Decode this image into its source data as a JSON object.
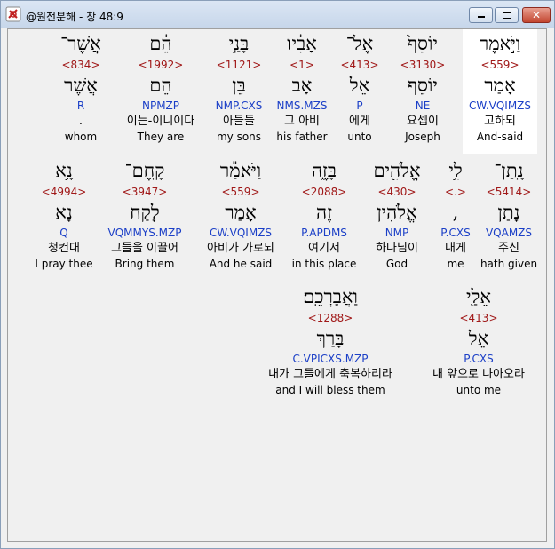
{
  "window": {
    "title": "@원전분해 - 창 48:9"
  },
  "controls": {
    "minimize": "–",
    "maximize": "□",
    "close": "✕"
  },
  "rows": [
    {
      "words": [
        {
          "heb": "וַיֹּ֣אמֶר",
          "num": "<559>",
          "lex": "אָמַר",
          "code": "CW.VQIMZS",
          "kor": "고하되",
          "eng": "And-said",
          "highlight": true
        },
        {
          "heb": "יוֹסֵף֙",
          "num": "<3130>",
          "lex": "יוֹסֵף",
          "code": "NE",
          "kor": "요셉이",
          "eng": "Joseph"
        },
        {
          "heb": "אֶל־",
          "num": "<413>",
          "lex": "אֵל",
          "code": "P",
          "kor": "에게",
          "eng": "unto"
        },
        {
          "heb": "אָבִ֔יו",
          "num": "<1>",
          "lex": "אָב",
          "code": "NMS.MZS",
          "kor": "그 아비",
          "eng": "his father"
        },
        {
          "heb": "בָּנַ֣י",
          "num": "<1121>",
          "lex": "בֵּן",
          "code": "NMP.CXS",
          "kor": "아들들",
          "eng": "my sons"
        },
        {
          "heb": "הֵ֔ם",
          "num": "<1992>",
          "lex": "הֵם",
          "code": "NPMZP",
          "kor": "이는-이니이다",
          "eng": "They are"
        },
        {
          "heb": "אֲשֶׁר־",
          "num": "<834>",
          "lex": "אֲשֶׁר",
          "code": "R",
          "kor": ".",
          "eng": "whom"
        }
      ]
    },
    {
      "words": [
        {
          "heb": "נָֽתַן־",
          "num": "<5414>",
          "lex": "נָתַן",
          "code": "VQAMZS",
          "kor": "주신",
          "eng": "hath given"
        },
        {
          "heb": "לִ֥י",
          "num": "<.>",
          "lex": ",",
          "code": "P.CXS",
          "kor": "내게",
          "eng": "me"
        },
        {
          "heb": "אֱלֹהִ֖ים",
          "num": "<430>",
          "lex": "אֱלֹהִין",
          "code": "NMP",
          "kor": "하나님이",
          "eng": "God"
        },
        {
          "heb": "בָּזֶ֑ה",
          "num": "<2088>",
          "lex": "זֶה",
          "code": "P.APDMS",
          "kor": "여기서",
          "eng": "in this place"
        },
        {
          "heb": "וַיֹּאמַ֕ר",
          "num": "<559>",
          "lex": "אָמַר",
          "code": "CW.VQIMZS",
          "kor": "아비가 가로되",
          "eng": "And he said"
        },
        {
          "heb": "קָֽחֶם־",
          "num": "<3947>",
          "lex": "לָקַח",
          "code": "VQMMYS.MZP",
          "kor": "그들을 이끌어",
          "eng": "Bring them"
        },
        {
          "heb": "נָ֥א",
          "num": "<4994>",
          "lex": "נָא",
          "code": "Q",
          "kor": "청컨대",
          "eng": "I pray thee"
        }
      ]
    },
    {
      "words": [
        {
          "heb": "אֵלַ֖י",
          "num": "<413>",
          "lex": "אֵל",
          "code": "P.CXS",
          "kor": "내 앞으로 나아오라",
          "eng": "unto me"
        },
        {
          "heb": "וַאֲבָרְכֵֽם׃",
          "num": "<1288>",
          "lex": "בָּרַךְ",
          "code": "C.VPICXS.MZP",
          "kor": "내가 그들에게 축복하리라",
          "eng": "and I will bless them"
        }
      ]
    }
  ]
}
